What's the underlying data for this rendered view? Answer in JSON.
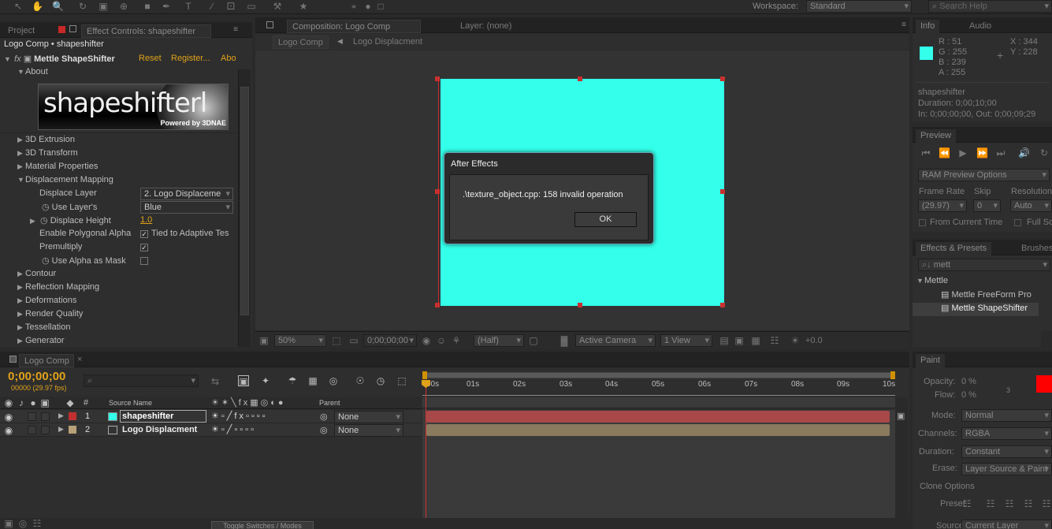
{
  "toolbar": {
    "workspace_label": "Workspace:",
    "workspace_value": "Standard",
    "search_placeholder": "Search Help"
  },
  "left_panel": {
    "tab_project": "Project",
    "tab_effect_controls": "Effect Controls: shapeshifter",
    "breadcrumb": "Logo Comp • shapeshifter",
    "effect_fx": "fx",
    "effect_name": "Mettle ShapeShifter",
    "reset": "Reset",
    "register": "Register...",
    "about": "Abo",
    "about_group": "About",
    "logo_text": "shapeshifterl",
    "logo_subtext": "Powered by 3DNAE",
    "groups": [
      "3D Extrusion",
      "3D Transform",
      "Material Properties"
    ],
    "displacement_group": "Displacement Mapping",
    "displace_layer_label": "Displace Layer",
    "displace_layer_value": "2. Logo Displaceme",
    "use_layers_label": "Use Layer's",
    "use_layers_value": "Blue",
    "displace_height_label": "Displace Height",
    "displace_height_value": "1.0",
    "poly_alpha_label": "Enable Polygonal Alpha",
    "poly_alpha_check": "Tied to Adaptive Tes",
    "premultiply_label": "Premultiply",
    "alpha_mask_label": "Use Alpha as Mask",
    "more_groups": [
      "Contour",
      "Reflection Mapping",
      "Deformations",
      "Render Quality",
      "Tessellation",
      "Generator"
    ]
  },
  "comp_panel": {
    "tab_comp": "Composition: Logo Comp",
    "tab_layer": "Layer: (none)",
    "crumb1": "Logo Comp",
    "crumb2": "Logo Displacment",
    "zoom": "50%",
    "timecode": "0;00;00;00",
    "resolution": "(Half)",
    "camera": "Active Camera",
    "view": "1 View",
    "exposure": "+0.0",
    "canvas_color": "#33ffea"
  },
  "dialog": {
    "title": "After Effects",
    "message": ".\\texture_object.cpp: 158 invalid operation",
    "ok": "OK"
  },
  "info_panel": {
    "tab_info": "Info",
    "tab_audio": "Audio",
    "r": "R : 51",
    "g": "G : 255",
    "b": "B : 239",
    "a": "A : 255",
    "x": "X : 344",
    "y": "Y : 228",
    "layer": "shapeshifter",
    "duration": "Duration: 0;00;10;00",
    "in_out": "In: 0;00;00;00, Out: 0;00;09;29"
  },
  "preview_panel": {
    "tab": "Preview",
    "ram_preview": "RAM Preview Options",
    "frame_rate_label": "Frame Rate",
    "skip_label": "Skip",
    "resolution_label": "Resolution",
    "frame_rate_value": "(29.97)",
    "skip_value": "0",
    "resolution_value": "Auto",
    "from_current": "From Current Time",
    "full_screen": "Full Sc"
  },
  "effects_panel": {
    "tab": "Effects & Presets",
    "tab_brushes": "Brushes",
    "search_value": "mett",
    "folder": "Mettle",
    "items": [
      "Mettle FreeForm Pro",
      "Mettle ShapeShifter"
    ]
  },
  "paint_panel": {
    "tab": "Paint",
    "opacity_label": "Opacity:",
    "opacity_value": "0 %",
    "flow_label": "Flow:",
    "flow_value": "0 %",
    "three": "3",
    "mode_label": "Mode:",
    "mode_value": "Normal",
    "channels_label": "Channels:",
    "channels_value": "RGBA",
    "duration_label": "Duration:",
    "duration_value": "Constant",
    "erase_label": "Erase:",
    "erase_value": "Layer Source & Paint",
    "clone_options": "Clone Options",
    "preset_label": "Preset:",
    "source_label": "Source:",
    "source_value": "Current Layer",
    "color": "#ff0000"
  },
  "timeline": {
    "tab": "Logo Comp",
    "timecode": "0;00;00;00",
    "frames": "00000 (29.97 fps)",
    "col_num": "#",
    "col_source": "Source Name",
    "col_parent": "Parent",
    "layers": [
      {
        "num": "1",
        "name": "shapeshifter",
        "parent": "None",
        "color": "#c03030",
        "bar": "#a84848"
      },
      {
        "num": "2",
        "name": "Logo Displacment",
        "parent": "None",
        "color": "#b8a078",
        "bar": "#8a7a5e"
      }
    ],
    "ruler": [
      "00s",
      "01s",
      "02s",
      "03s",
      "04s",
      "05s",
      "06s",
      "07s",
      "08s",
      "09s",
      "10s"
    ],
    "toggle_label": "Toggle Switches / Modes"
  }
}
